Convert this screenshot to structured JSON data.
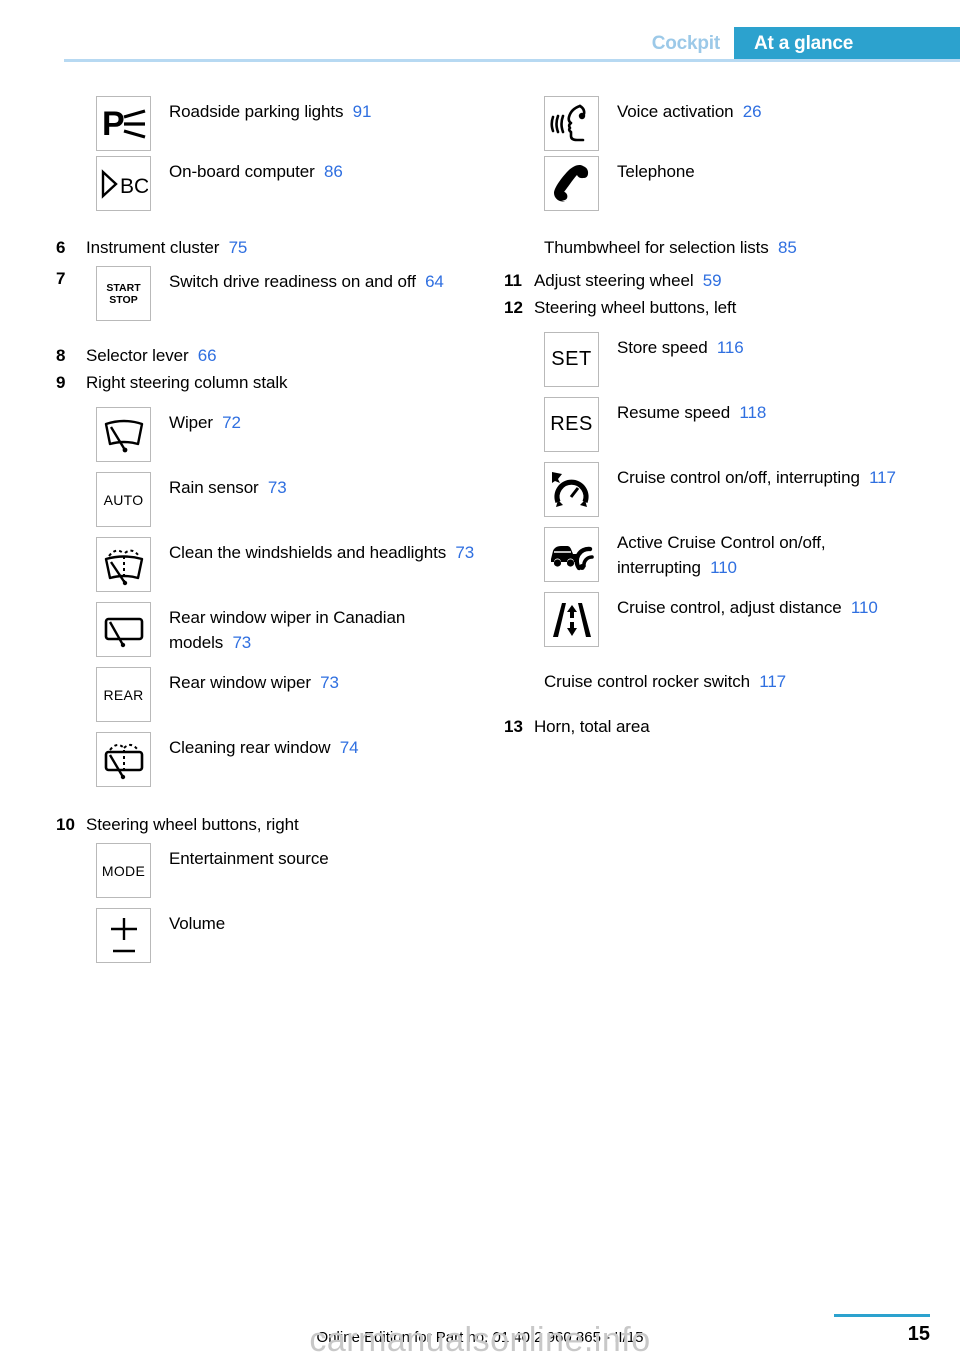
{
  "header": {
    "chapter": "Cockpit",
    "section": "At a glance",
    "accent_color": "#2ca2ce",
    "chapter_color": "#9cc9e8",
    "rule_color": "#b7d9f2"
  },
  "theme": {
    "page_ref_color": "#2f6fe0",
    "icon_border_color": "#b9b9b9",
    "text_color": "#000000"
  },
  "left_column": [
    {
      "kind": "icon",
      "num": "",
      "icon": "parking-lights-icon",
      "icon_text": "P",
      "label": "Roadside parking lights",
      "page": "91"
    },
    {
      "kind": "icon",
      "num": "",
      "icon": "on-board-computer-icon",
      "icon_text": "BC",
      "label": "On-board computer",
      "page": "86"
    },
    {
      "kind": "plain",
      "num": "6",
      "label": "Instrument cluster",
      "page": "75"
    },
    {
      "kind": "icon",
      "num": "7",
      "icon": "start-stop-icon",
      "icon_text": "START STOP",
      "label": "Switch drive readiness on and off",
      "page": "64"
    },
    {
      "kind": "plain",
      "num": "8",
      "label": "Selector lever",
      "page": "66"
    },
    {
      "kind": "plain",
      "num": "9",
      "label": "Right steering column stalk",
      "page": ""
    },
    {
      "kind": "icon",
      "num": "",
      "icon": "wiper-icon",
      "icon_text": "",
      "label": "Wiper",
      "page": "72"
    },
    {
      "kind": "icon",
      "num": "",
      "icon": "rain-sensor-auto-icon",
      "icon_text": "AUTO",
      "label": "Rain sensor",
      "page": "73"
    },
    {
      "kind": "icon",
      "num": "",
      "icon": "clean-windshield-headlights-icon",
      "icon_text": "",
      "label": "Clean the windshields and headlights",
      "page": "73"
    },
    {
      "kind": "icon",
      "num": "",
      "icon": "rear-window-wiper-canadian-icon",
      "icon_text": "",
      "label": "Rear window wiper in Canadian models",
      "page": "73"
    },
    {
      "kind": "icon",
      "num": "",
      "icon": "rear-window-wiper-icon",
      "icon_text": "REAR",
      "label": "Rear window wiper",
      "page": "73"
    },
    {
      "kind": "icon",
      "num": "",
      "icon": "cleaning-rear-window-icon",
      "icon_text": "",
      "label": "Cleaning rear window",
      "page": "74"
    },
    {
      "kind": "plain",
      "num": "10",
      "label": "Steering wheel buttons, right",
      "page": ""
    },
    {
      "kind": "icon",
      "num": "",
      "icon": "mode-icon",
      "icon_text": "MODE",
      "label": "Entertainment source",
      "page": ""
    },
    {
      "kind": "icon",
      "num": "",
      "icon": "volume-icon",
      "icon_text": "",
      "label": "Volume",
      "page": ""
    }
  ],
  "right_column": [
    {
      "kind": "icon",
      "num": "",
      "icon": "voice-activation-icon",
      "icon_text": "",
      "label": "Voice activation",
      "page": "26"
    },
    {
      "kind": "icon",
      "num": "",
      "icon": "telephone-icon",
      "icon_text": "",
      "label": "Telephone",
      "page": ""
    },
    {
      "kind": "text-indent",
      "num": "",
      "label": "Thumbwheel for selection lists",
      "page": "85"
    },
    {
      "kind": "plain",
      "num": "11",
      "label": "Adjust steering wheel",
      "page": "59"
    },
    {
      "kind": "plain",
      "num": "12",
      "label": "Steering wheel buttons, left",
      "page": ""
    },
    {
      "kind": "icon",
      "num": "",
      "icon": "set-icon",
      "icon_text": "SET",
      "label": "Store speed",
      "page": "116"
    },
    {
      "kind": "icon",
      "num": "",
      "icon": "res-icon",
      "icon_text": "RES",
      "label": "Resume speed",
      "page": "118"
    },
    {
      "kind": "icon",
      "num": "",
      "icon": "cruise-control-onoff-icon",
      "icon_text": "",
      "label": "Cruise control on/off, interrupting",
      "page": "117"
    },
    {
      "kind": "icon",
      "num": "",
      "icon": "active-cruise-control-onoff-icon",
      "icon_text": "",
      "label": "Active Cruise Control on/off, interrupting",
      "page": "110"
    },
    {
      "kind": "icon",
      "num": "",
      "icon": "cruise-control-distance-icon",
      "icon_text": "",
      "label": "Cruise control, adjust distance",
      "page": "110"
    },
    {
      "kind": "text-indent",
      "num": "",
      "label": "Cruise control rocker switch",
      "page": "117"
    },
    {
      "kind": "plain",
      "num": "13",
      "label": "Horn, total area",
      "page": ""
    }
  ],
  "footer": {
    "edition_line": "Online Edition for Part no. 01 40 2 960 865 - II/15",
    "page_number": "15",
    "watermark": "carmanualsonline.info"
  }
}
